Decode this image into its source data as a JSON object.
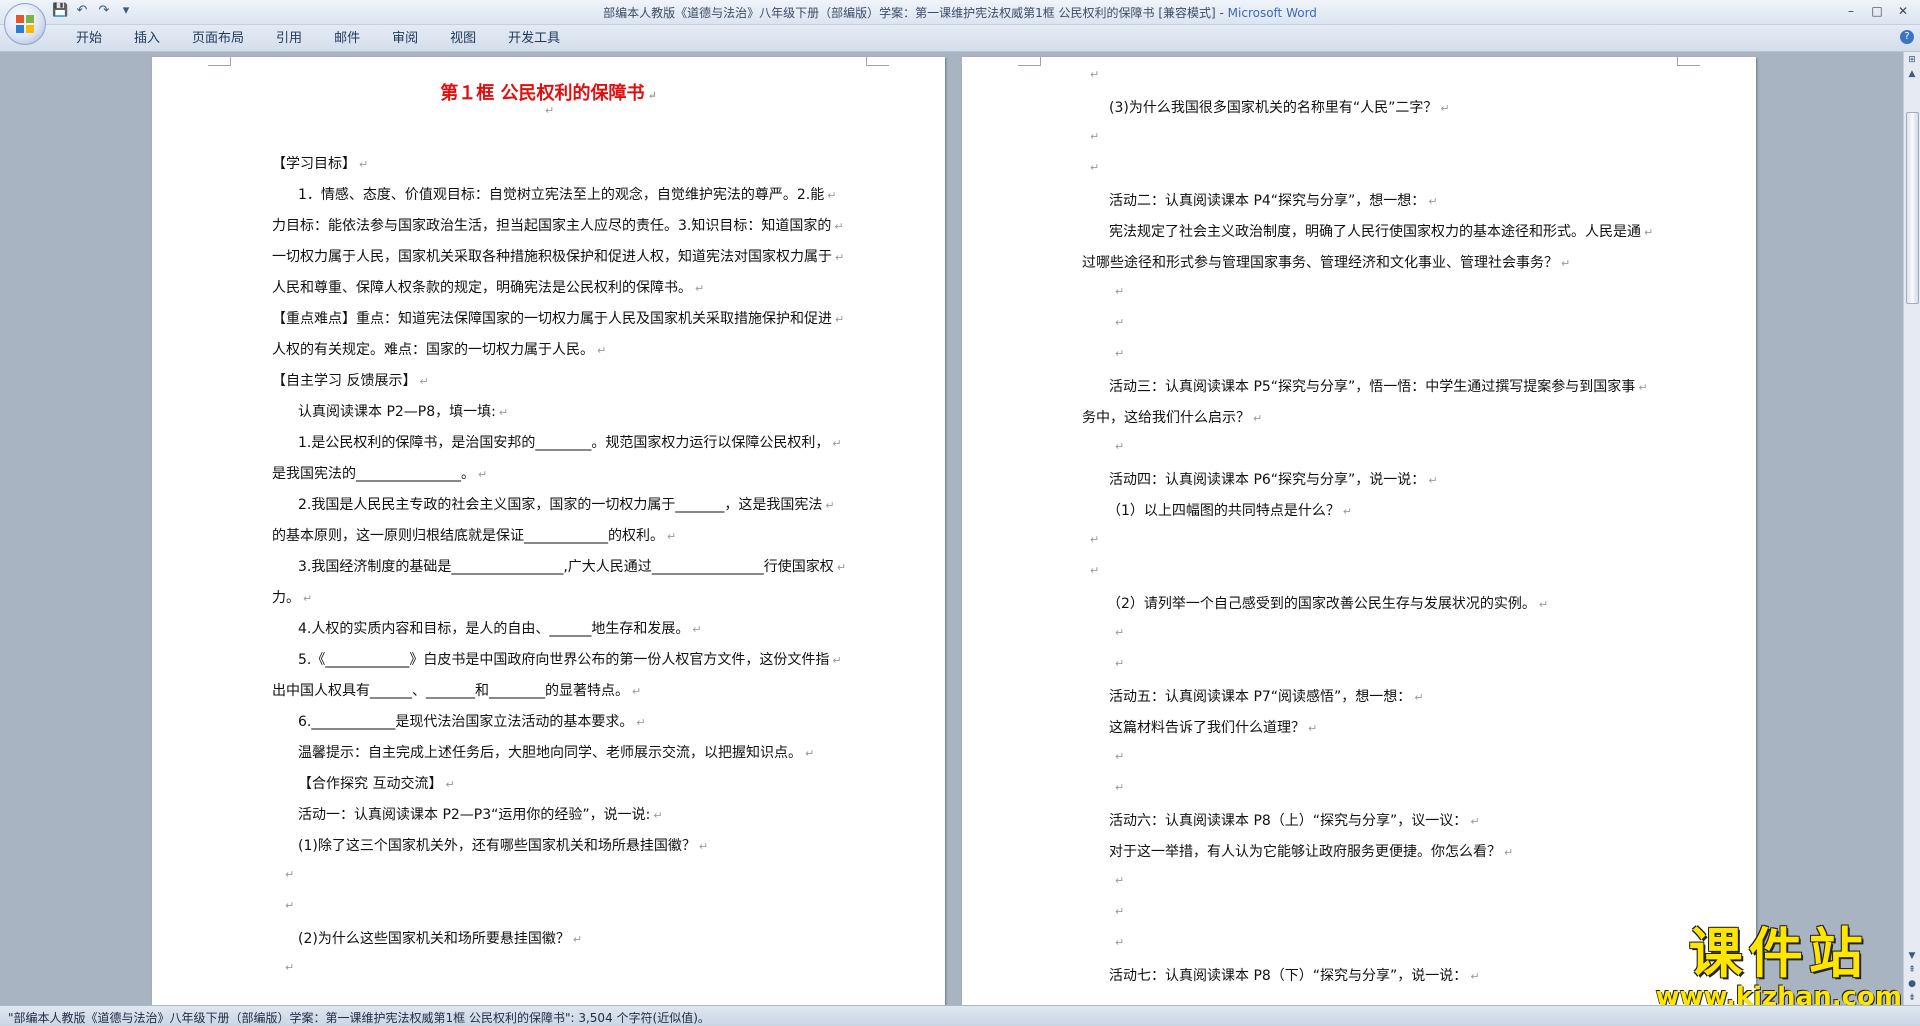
{
  "window": {
    "title_doc": "部编本人教版《道德与法治》八年级下册（部编版）学案：第一课维护宪法权威第1框 公民权利的保障书 [兼容模式] - ",
    "title_app": "Microsoft Word",
    "controls": {
      "minimize": "–",
      "maximize": "□",
      "close": "✕"
    }
  },
  "ribbon": {
    "tabs": [
      "开始",
      "插入",
      "页面布局",
      "引用",
      "邮件",
      "审阅",
      "视图",
      "开发工具"
    ],
    "help": "?"
  },
  "page1": {
    "heading": "第１框  公民权利的保障书",
    "lines": [
      "",
      "【学习目标】",
      "1．情感、态度、价值观目标：自觉树立宪法至上的观念，自觉维护宪法的尊严。2.能",
      "力目标：能依法参与国家政治生活，担当起国家主人应尽的责任。3.知识目标：知道国家的",
      "一切权力属于人民，国家机关采取各种措施积极保护和促进人权，知道宪法对国家权力属于",
      "人民和尊重、保障人权条款的规定，明确宪法是公民权利的保障书。",
      "【重点难点】重点：知道宪法保障国家的一切权力属于人民及国家机关采取措施保护和促进",
      "人权的有关规定。难点：国家的一切权力属于人民。",
      "【自主学习 反馈展示】",
      "认真阅读课本 P2—P8，填一填:",
      "1.是公民权利的保障书，是治国安邦的________。规范国家权力运行以保障公民权利，",
      "是我国宪法的_______________。",
      "2.我国是人民民主专政的社会主义国家，国家的一切权力属于_______，这是我国宪法",
      "的基本原则，这一原则归根结底就是保证____________的权利。",
      "3.我国经济制度的基础是________________,广大人民通过________________行使国家权",
      "力。",
      "4.人权的实质内容和目标，是人的自由、______地生存和发展。",
      "5.《____________》白皮书是中国政府向世界公布的第一份人权官方文件，这份文件指",
      "出中国人权具有______、_______和________的显著特点。",
      "6.____________是现代法治国家立法活动的基本要求。",
      "温馨提示：自主完成上述任务后，大胆地向同学、老师展示交流，以把握知识点。",
      "【合作探究 互动交流】",
      "活动一：认真阅读课本 P2—P3“运用你的经验”，说一说:",
      "(1)除了这三个国家机关外，还有哪些国家机关和场所悬挂国徽？",
      "",
      "",
      "(2)为什么这些国家机关和场所要悬挂国徽？",
      ""
    ]
  },
  "page2": {
    "lines": [
      "",
      "(3)为什么我国很多国家机关的名称里有“人民”二字？",
      "",
      "",
      "活动二：认真阅读课本 P4“探究与分享”，想一想：",
      "宪法规定了社会主义政治制度，明确了人民行使国家权力的基本途径和形式。人民是通",
      "过哪些途径和形式参与管理国家事务、管理经济和文化事业、管理社会事务？",
      "",
      "",
      "",
      "活动三：认真阅读课本 P5“探究与分享”，悟一悟：中学生通过撰写提案参与到国家事",
      "务中，这给我们什么启示？",
      "",
      "活动四：认真阅读课本 P6“探究与分享”，说一说：",
      "（1）以上四幅图的共同特点是什么？",
      "",
      "",
      "（2）请列举一个自己感受到的国家改善公民生存与发展状况的实例。",
      "",
      "",
      "活动五：认真阅读课本 P7“阅读感悟”，想一想：",
      "这篇材料告诉了我们什么道理？",
      "",
      "",
      "活动六：认真阅读课本 P8（上）“探究与分享”，议一议：",
      "对于这一举措，有人认为它能够让政府服务更便捷。你怎么看？",
      "",
      "",
      "",
      "活动七：认真阅读课本 P8（下）“探究与分享”，说一说："
    ]
  },
  "paragraph_mark": "↵",
  "status": {
    "text": "\"部编本人教版《道德与法治》八年级下册（部编版）学案：第一课维护宪法权威第1框 公民权利的保障书\": 3,504 个字符(近似值)。"
  },
  "watermark": {
    "title": "课件站",
    "url": "www.kjzhan.com"
  },
  "colors": {
    "title_red": "#e01010",
    "word_blue": "#3a6bb8",
    "watermark_yellow": "#ffe600"
  }
}
